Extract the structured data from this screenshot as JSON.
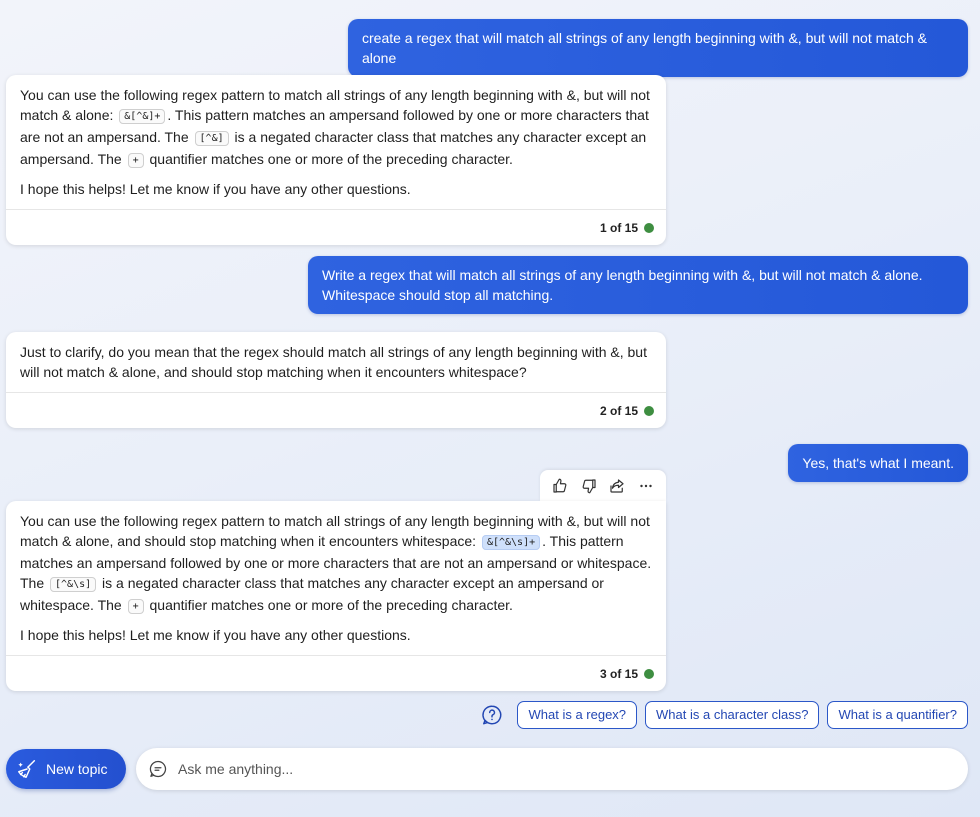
{
  "messages": {
    "user1": "create a regex that will match all strings of any length beginning with &, but will not match & alone",
    "bot1": {
      "p1_a": "You can use the following regex pattern to match all strings of any length beginning with &, but will not match & alone: ",
      "p1_code1": "&[^&]+",
      "p1_b": ". This pattern matches an ampersand followed by one or more characters that are not an ampersand. The ",
      "p1_code2": "[^&]",
      "p1_c": " is a negated character class that matches any character except an ampersand. The ",
      "p1_code3": "+",
      "p1_d": " quantifier matches one or more of the preceding character.",
      "p2": "I hope this helps! Let me know if you have any other questions.",
      "counter": "1 of 15"
    },
    "user2": "Write a regex that will match all strings of any length beginning with &, but will not match & alone. Whitespace should stop all matching.",
    "bot2": {
      "p1": "Just to clarify, do you mean that the regex should match all strings of any length beginning with &, but will not match & alone, and should stop matching when it encounters whitespace?",
      "counter": "2 of 15"
    },
    "user3": "Yes, that's what I meant.",
    "bot3": {
      "p1_a": "You can use the following regex pattern to match all strings of any length beginning with &, but will not match & alone, and should stop matching when it encounters whitespace: ",
      "p1_code1": "&[^&\\s]+",
      "p1_b": ". This pattern matches an ampersand followed by one or more characters that are not an ampersand or whitespace. The ",
      "p1_code2": "[^&\\s]",
      "p1_c": " is a negated character class that matches any character except an ampersand or whitespace. The ",
      "p1_code3": "+",
      "p1_d": " quantifier matches one or more of the preceding character.",
      "p2": "I hope this helps! Let me know if you have any other questions.",
      "counter": "3 of 15"
    }
  },
  "actions": {
    "icons": [
      "thumbs-up-icon",
      "thumbs-down-icon",
      "share-icon",
      "more-icon"
    ]
  },
  "suggestions": [
    "What is a regex?",
    "What is a character class?",
    "What is a quantifier?"
  ],
  "composer": {
    "new_topic_label": "New topic",
    "placeholder": "Ask me anything..."
  },
  "colors": {
    "accent": "#2b5cdc",
    "status_dot": "#3e8e41"
  }
}
